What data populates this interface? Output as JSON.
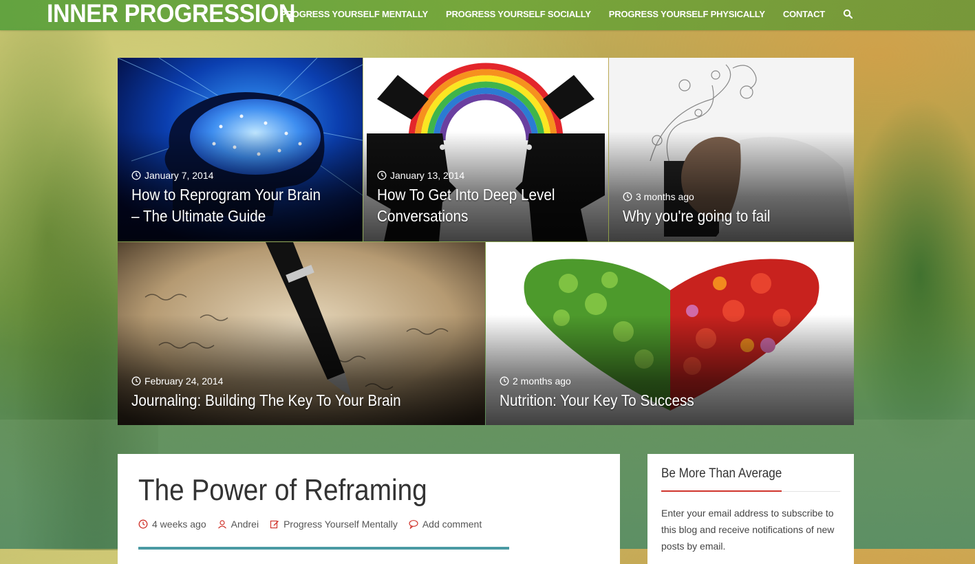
{
  "header": {
    "site_title": "INNER PROGRESSION",
    "nav": [
      {
        "label": "PROGRESS YOURSELF MENTALLY"
      },
      {
        "label": "PROGRESS YOURSELF SOCIALLY"
      },
      {
        "label": "PROGRESS YOURSELF PHYSICALLY"
      },
      {
        "label": "CONTACT"
      }
    ],
    "search_icon": "search-icon"
  },
  "featured": [
    {
      "date": "January 7, 2014",
      "title": "How to Reprogram Your Brain – The Ultimate Guide",
      "image": "glowing-brain"
    },
    {
      "date": "January 13, 2014",
      "title": "How To Get Into Deep Level Conversations",
      "image": "rainbow-heads"
    },
    {
      "date": "3 months ago",
      "title": "Why you're going to fail",
      "image": "man-on-laptop"
    },
    {
      "date": "February 24, 2014",
      "title": "Journaling: Building The Key To Your Brain",
      "image": "fountain-pen"
    },
    {
      "date": "2 months ago",
      "title": "Nutrition: Your Key To Success",
      "image": "vegetable-heart"
    }
  ],
  "article": {
    "title": "The Power of Reframing",
    "time": "4 weeks ago",
    "author": "Andrei",
    "category": "Progress Yourself Mentally",
    "comments": "Add comment"
  },
  "widget": {
    "title": "Be More Than Average",
    "text": "Enter your email address to subscribe to this blog and receive notifications of new posts by email."
  },
  "colors": {
    "header_green": "#6aa63d",
    "accent_red": "#d0342c",
    "text_dark": "#333333"
  }
}
